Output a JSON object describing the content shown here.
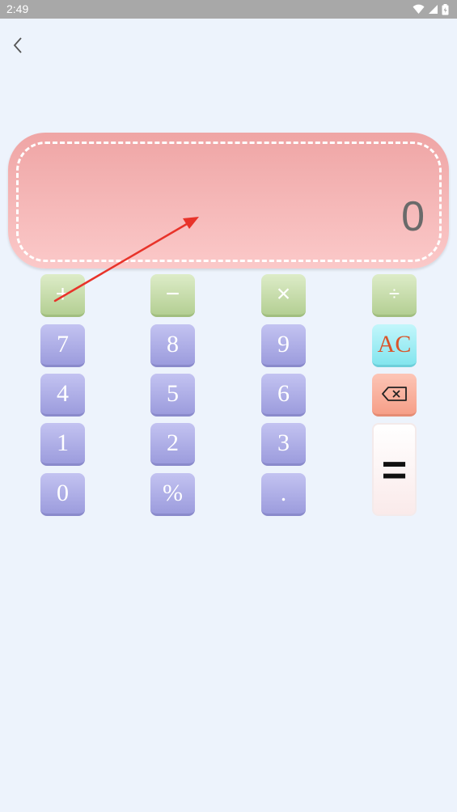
{
  "status_bar": {
    "time": "2:49",
    "icons": [
      "wifi-icon",
      "signal-icon",
      "battery-icon"
    ]
  },
  "header": {
    "back_icon": "chevron-left-icon"
  },
  "display": {
    "value": "0"
  },
  "keypad": {
    "plus": "+",
    "minus": "−",
    "multiply": "×",
    "divide": "÷",
    "seven": "7",
    "eight": "8",
    "nine": "9",
    "clear": "AC",
    "four": "4",
    "five": "5",
    "six": "6",
    "backspace_icon": "backspace-icon",
    "one": "1",
    "two": "2",
    "three": "3",
    "equals": "=",
    "zero": "0",
    "percent": "%",
    "dot": "."
  },
  "colors": {
    "background": "#EDF3FC",
    "number_key": "#A9A9E6",
    "operator_key": "#C3DBA6",
    "clear_key": "#9DEBF3",
    "clear_text": "#D9552B",
    "delete_key": "#F8AE9A",
    "display_pink": "#F6B8B8",
    "annotation_arrow": "#E8332A"
  }
}
